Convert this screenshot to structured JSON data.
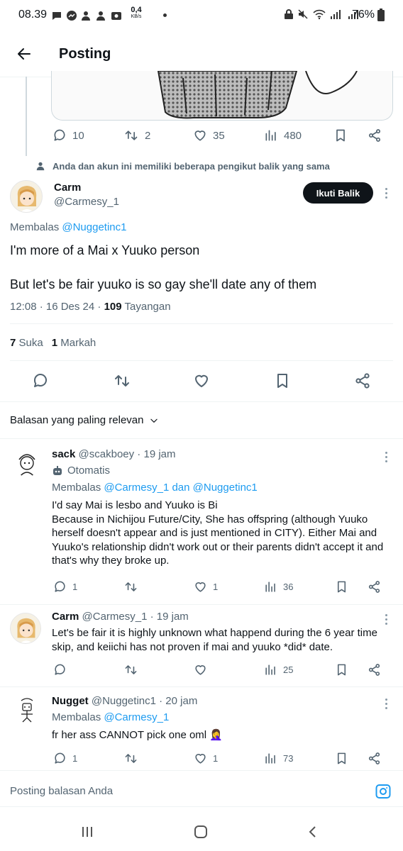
{
  "status_bar": {
    "time": "08.39",
    "net_speed_value": "0,4",
    "net_speed_unit": "KB/s",
    "battery": "76%"
  },
  "header": {
    "title": "Posting"
  },
  "prev_tweet": {
    "actions": {
      "replies": "10",
      "retweets": "2",
      "likes": "35",
      "views": "480"
    }
  },
  "mutual_notice": "Anda dan akun ini memiliki beberapa pengikut balik yang sama",
  "main_tweet": {
    "name": "Carm",
    "handle": "@Carmesy_1",
    "follow_label": "Ikuti Balik",
    "replying_prefix": "Membalas",
    "replying_to": "@Nuggetinc1",
    "line1": "I'm more of a Mai x Yuuko person",
    "line2": "But let's be fair yuuko is so gay she'll date any of them",
    "timestamp": "12:08 · 16 Des 24 ·",
    "views_count": "109",
    "views_label": "Tayangan",
    "likes_count": "7",
    "likes_label": "Suka",
    "bookmarks_count": "1",
    "bookmarks_label": "Markah"
  },
  "sort_label": "Balasan yang paling relevan",
  "replies": [
    {
      "name": "sack",
      "handle_time": "@scakboey · 19 jam",
      "automated": "Otomatis",
      "replying_prefix": "Membalas",
      "replying_to": "@Carmesy_1 dan @Nuggetinc1",
      "text": "I'd say Mai is lesbo and Yuuko is Bi\nBecause in Nichijou Future/City, She has offspring (although Yuuko herself doesn't appear and is just mentioned in CITY). Either Mai and Yuuko's relationship didn't work out or their parents didn't accept it and that's why they broke up.",
      "replies": "1",
      "retweets": "",
      "likes": "1",
      "views": "36"
    },
    {
      "name": "Carm",
      "handle_time": "@Carmesy_1 · 19 jam",
      "text": "Let's be fair it is highly unknown what happend during the 6 year time skip, and keiichi has not proven if mai and yuuko *did* date.",
      "replies": "",
      "retweets": "",
      "likes": "",
      "views": "25"
    },
    {
      "name": "Nugget",
      "handle_time": "@Nuggetinc1 · 20 jam",
      "replying_prefix": "Membalas",
      "replying_to": "@Carmesy_1",
      "text": "fr her ass CANNOT pick one oml 🤦‍♀️",
      "replies": "1",
      "retweets": "",
      "likes": "1",
      "views": "73"
    }
  ],
  "composer": {
    "placeholder": "Posting balasan Anda"
  }
}
